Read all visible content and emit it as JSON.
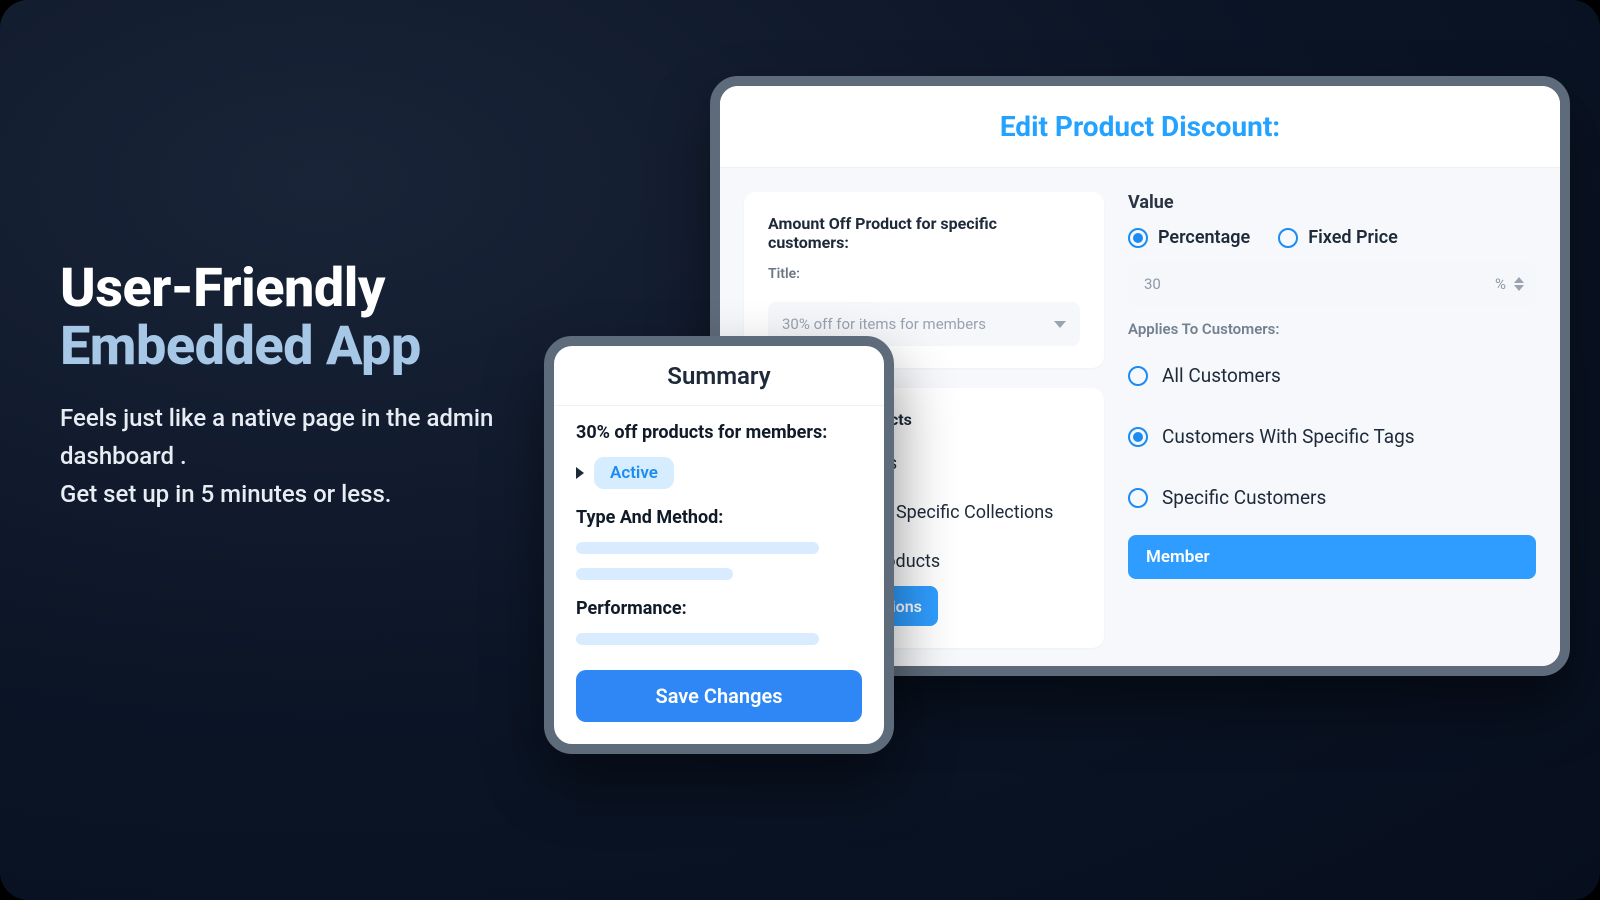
{
  "hero": {
    "title_line1": "User-Friendly",
    "title_line2": "Embedded App",
    "body_line1": "Feels just like a native page in the admin dashboard .",
    "body_line2": "Get set up in 5 minutes or less."
  },
  "editor": {
    "title": "Edit Product Discount:",
    "amount_off": {
      "heading": "Amount Off Product for specific customers:",
      "title_label": "Title:",
      "selected": "30% off for items for members"
    },
    "applies_products": {
      "heading": "Applies To Products",
      "options": {
        "all": "All Products",
        "collections": "Products In Specific Collections",
        "specific": "Specific Products"
      },
      "button": "Browse Collections"
    },
    "value": {
      "heading": "Value",
      "percentage": "Percentage",
      "fixed": "Fixed Price",
      "amount": "30",
      "unit": "%"
    },
    "applies_customers": {
      "heading": "Applies To Customers:",
      "options": {
        "all": "All Customers",
        "tags": "Customers With Specific Tags",
        "specific": "Specific Customers"
      },
      "tag": "Member"
    }
  },
  "summary": {
    "header": "Summary",
    "title": "30% off products for members:",
    "status": "Active",
    "type_method_label": "Type And Method:",
    "performance_label": "Performance:",
    "save": "Save Changes"
  }
}
